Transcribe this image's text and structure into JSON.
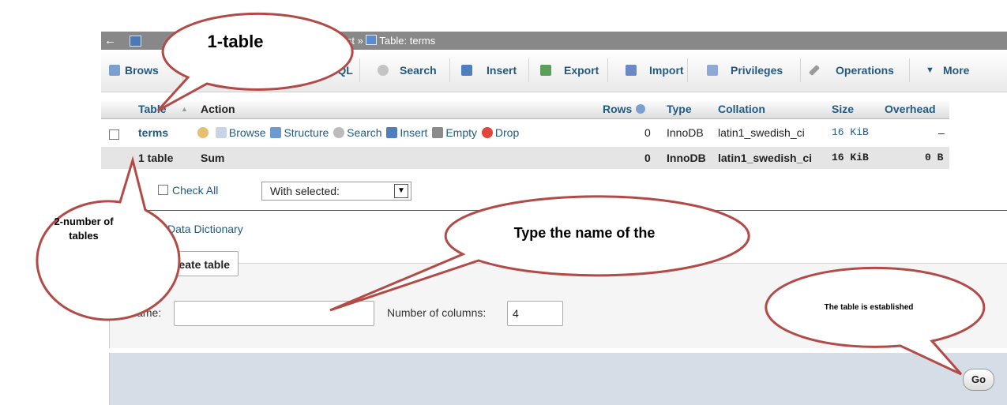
{
  "breadcrumb": {
    "back": "←",
    "tail": "test » ",
    "table_label": "Table: terms"
  },
  "tabs": [
    {
      "label": "Brows",
      "icon": "browse-icon"
    },
    {
      "label": "SQL",
      "icon": "sql-icon"
    },
    {
      "label": "Search",
      "icon": "search-icon"
    },
    {
      "label": "Insert",
      "icon": "insert-icon"
    },
    {
      "label": "Export",
      "icon": "export-icon"
    },
    {
      "label": "Import",
      "icon": "import-icon"
    },
    {
      "label": "Privileges",
      "icon": "privileges-icon"
    },
    {
      "label": "Operations",
      "icon": "wrench-icon"
    },
    {
      "label": "More",
      "icon": "triangle-down-icon"
    }
  ],
  "table_list": {
    "headers": {
      "table": "Table",
      "sort": "▲",
      "action": "Action",
      "rows": "Rows",
      "type": "Type",
      "collation": "Collation",
      "size": "Size",
      "overhead": "Overhead"
    },
    "row": {
      "name": "terms",
      "actions": [
        "Browse",
        "Structure",
        "Search",
        "Insert",
        "Empty",
        "Drop"
      ],
      "rows": "0",
      "type": "InnoDB",
      "collation": "latin1_swedish_ci",
      "size": "16 KiB",
      "overhead": "–"
    },
    "sum": {
      "count": "1 table",
      "label": "Sum",
      "rows": "0",
      "type": "InnoDB",
      "collation": "latin1_swedish_ci",
      "size": "16 KiB",
      "overhead": "0 B"
    }
  },
  "bulk": {
    "check_all": "Check All",
    "with_selected": "With selected:",
    "arrow": "▼"
  },
  "links": {
    "print_view_tail": "w",
    "data_dictionary": "Data Dictionary"
  },
  "create": {
    "legend": "eate table",
    "name_label": "Name:",
    "name_value": "",
    "cols_label": "Number of columns:",
    "cols_value": "4",
    "go": "Go"
  },
  "callouts": {
    "c1": "1-table",
    "c2_line1": "2-number of",
    "c2_line2": "tables",
    "c3": "Type the name of the",
    "c4": "The table is established"
  },
  "colors": {
    "callout_stroke": "#b24b47",
    "link": "#235a81",
    "breadcrumb_bg": "#888888"
  }
}
